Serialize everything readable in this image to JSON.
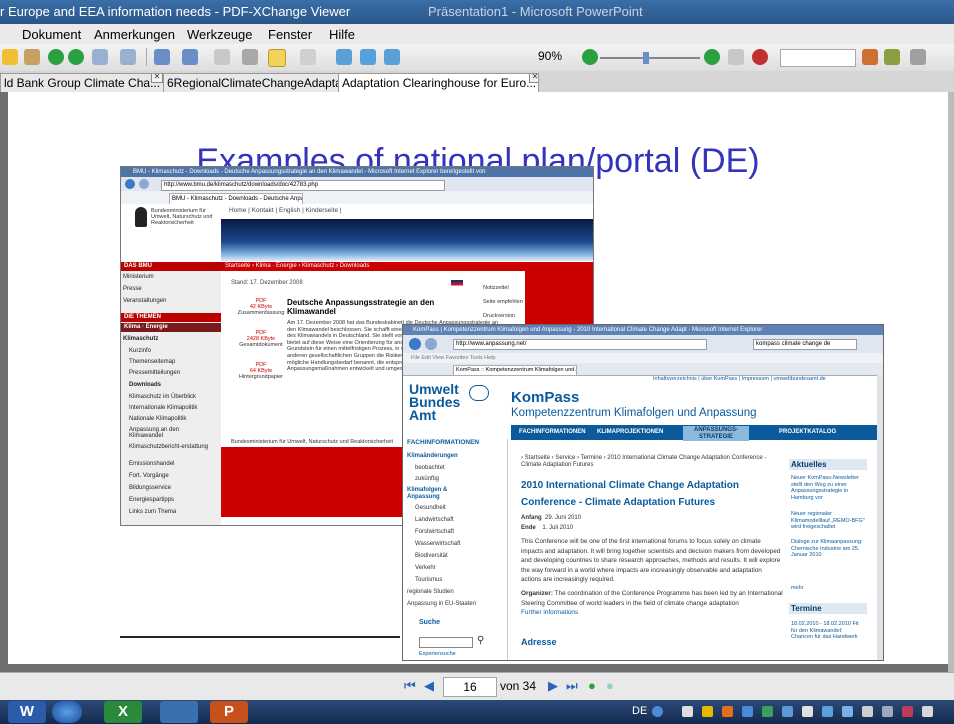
{
  "window": {
    "title": "r Europe and EEA information needs - PDF-XChange Viewer",
    "background_title": "Präsentation1 - Microsoft PowerPoint"
  },
  "menu": [
    "Dokument",
    "Anmerkungen",
    "Werkzeuge",
    "Fenster",
    "Hilfe"
  ],
  "toolbar": {
    "zoom": "90%"
  },
  "tabs": [
    {
      "label": "ld Bank Group Climate Cha...",
      "active": false
    },
    {
      "label": "6RegionalClimateChangeAdaptati...",
      "active": false
    },
    {
      "label": "Adaptation Clearinghouse for Euro...",
      "active": true
    }
  ],
  "slide": {
    "title": "Examples of national plan/portal (DE)",
    "screenshot1": {
      "window_title": "BMU - Klimaschutz - Downloads - Deutsche Anpassungsstrategie an den Klimawandel - Microsoft Internet Explorer bereitgestellt von",
      "url": "http://www.bmu.de/klimaschutz/downloads/doc/42783.php",
      "tab": "BMU - Klimaschutz - Downloads - Deutsche Anpassung...",
      "ministry": "Bundesministerium für Umwelt, Naturschutz und Reaktorsicherheit",
      "topnav": "Home  |  Kontakt  |  English  |  Kinderseite  |",
      "breadcrumb": "Startseite › Klima · Energie › Klimaschutz › Downloads",
      "side_header1": "DAS BMU",
      "side_items1": [
        "Ministerium",
        "Presse",
        "Veranstaltungen"
      ],
      "side_header2": "DIE THEMEN",
      "side_header3": "Klima · Energie",
      "side_bold": "Klimaschutz",
      "side_items2": [
        "Kurzinfo",
        "Themenseitemap",
        "Pressemitteilungen"
      ],
      "side_bold2": "Downloads",
      "side_items3": [
        "Klimaschutz im Überblick",
        "Internationale Klimapolitik",
        "Nationale Klimapolitik",
        "Anpassung an den Klimawandel",
        "Klimaschutzbericht-erstattung",
        "Emissionshandel",
        "Fort. Vorgänge",
        "Bildungsservice",
        "Energiespartipps",
        "Links zum Thema"
      ],
      "date": "Stand: 17. Dezember 2008",
      "doc_title": "Deutsche Anpassungsstrategie an den Klimawandel",
      "pdfs": [
        {
          "label": "PDF",
          "size": "42 KByte",
          "desc": "Zusammenfassung"
        },
        {
          "label": "PDF",
          "size": "2428 KByte",
          "desc": "Gesamtdokument"
        },
        {
          "label": "PDF",
          "size": "64 KByte",
          "desc": "Hintergrundpapier"
        }
      ],
      "body": "Am 17. Dezember 2008 hat das Bundeskabinett die Deutsche Anpassungsstrategie an den Klimawandel beschlossen. Sie schafft einen Rahmen zur Anpassung an die Folgen des Klimawandels in Deutschland. Sie stellt vor allem den Beitrag des Bundes dar und bietet auf diese Weise eine Orientierung für andere Akteure. Die Strategie legt den Grundstein für einen mittelfristigen Prozess, in dem schrittweise mit den Ländern und anderen gesellschaftlichen Gruppen die Risiken des Klimawandels bewertet, der mögliche Handlungsbedarf benannt, die entsprechenden Ziele definiert sowie mögliche Anpassungsmaßnahmen entwickelt und umgesetzt werden.",
      "right_links": [
        "Notizzettel",
        "Seite empfehlen",
        "Druckversion"
      ],
      "footer": "Bundesministerium für Umwelt, Naturschutz und Reaktorsicherheit"
    },
    "screenshot2": {
      "window_title": "KomPass | Kompetenzzentrum Klimafolgen und Anpassung - 2010 International Climate Change Adapt - Microsoft Internet Explorer",
      "url": "http://www.anpassung.net/",
      "search": "kompass climate change de",
      "menu": "File   Edit   View   Favorites   Tools   Help",
      "tab": "KomPass :: Kompetenzzentrum Klimafolgen und Anpas...",
      "toplinks": "Inhaltsverzeichnis  |  über KomPass  |  Impressum  |  umweltbundesamt.de",
      "uba": "Umwelt Bundes Amt",
      "kp_title": "KomPass",
      "kp_subtitle": "Kompetenzzentrum Klimafolgen und Anpassung",
      "nav": [
        "FACHINFORMATIONEN",
        "KLIMAPROJEKTIONEN",
        "ANPASSUNGS-STRATEGIE",
        "PROJEKTKATALOG"
      ],
      "side_header": "FACHINFORMATIONEN",
      "side_h1": "Klimaänderungen",
      "side_i1": [
        "beobachtet",
        "zukünftig"
      ],
      "side_h2": "Klimafolgen & Anpassung",
      "side_i2": [
        "Gesundheit",
        "Landwirtschaft",
        "Forstwirtschaft",
        "Wasserwirtschaft",
        "Biodiversität",
        "Verkehr",
        "Tourismus"
      ],
      "side_i3": [
        "regionale Studien",
        "Anpassung in EU-Staaten"
      ],
      "suche": "Suche",
      "expertensuche": "Expertensuche",
      "breadcrumb": "› Startseite › Service › Termine › 2010 International Climate Change Adaptation Conference - Climate Adaptation Futures",
      "heading": "2010 International Climate Change Adaptation Conference - Climate Adaptation Futures",
      "anfang_label": "Anfang",
      "anfang": "29. Juni 2010",
      "ende_label": "Ende",
      "ende": "1. Juli 2010",
      "para1": "This Conference will be one of the first international forums to focus solely on climate impacts and adaptation.  It will bring together scientists and decision makers from developed and developing countries to share research approaches, methods and results.  It will explore the way forward in a world where impacts are increasingly observable and adaptation actions are increasingly required.",
      "para2_label": "Organizer:",
      "para2": "The coordination of the Conference Programme has been led by an International Steering Committee of world leaders in the field of climate change adaptation",
      "further": "Further informations",
      "adresse": "Adresse",
      "aktuelles": "Aktuelles",
      "news": [
        "Neuer KomPass-Newsletter stellt den Weg zu einer Anpassungsstrategie in Hamburg vor",
        "Neuer regionaler Klimamodelllauf „REMO-BFG\" wird freigeschaltet",
        "Dialoge zur Klimaanpassung: Chemische Industrie am 25. Januar 2010",
        "mehr"
      ],
      "termine": "Termine",
      "termine_items": [
        "18.02.2010 - 18.02.2010 Fit für den Klimawandel: Chancen für das Handwerk"
      ]
    }
  },
  "navbar": {
    "page": "16",
    "of": "von 34"
  },
  "taskbar": {
    "lang": "DE"
  }
}
